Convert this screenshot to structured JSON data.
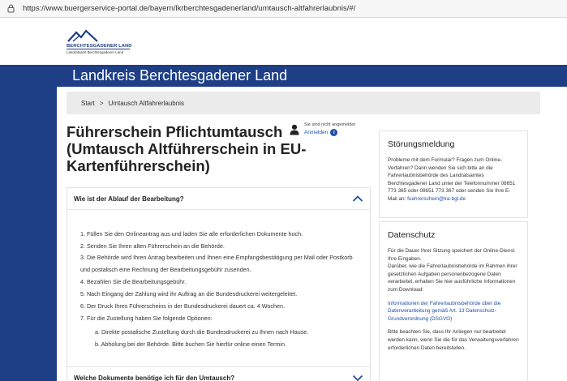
{
  "browser": {
    "url": "https://www.buergerservice-portal.de/bayern/lkrberchtesgadenerland/umtausch-altfahrerlaubnis/#/"
  },
  "logo": {
    "title": "BERCHTESGADENER LAND",
    "subtitle": "Landratsamt Berchtesgadener Land"
  },
  "banner": {
    "title": "Landkreis Berchtesgadener Land"
  },
  "breadcrumb": {
    "home": "Start",
    "separator": ">",
    "current": "Umtausch Altfahrerlaubnis"
  },
  "page": {
    "title": "Führerschein Pflichtumtausch (Umtausch Altführerschein in EU-Kartenführerschein)"
  },
  "login": {
    "state": "Sie sind nicht angemeldet",
    "link": "Anmelden",
    "info_icon": "i"
  },
  "accordion1": {
    "title": "Wie ist der Ablauf der Bearbeitung?",
    "steps": [
      "1. Füllen Sie den Onlineantrag aus und laden Sie alle erforderlichen Dokumente hoch.",
      "2. Senden Sie Ihren alten Führerschein an die Behörde.",
      "3. Die Behörde wird Ihren Antrag bearbeiten und Ihnen eine Empfangsbestätigung per Mail oder Postkorb und postalisch eine Rechnung der Bearbeitungsgebühr zusenden.",
      "4. Bezahlen Sie die Bearbeitungsgebühr.",
      "5. Nach Eingang der Zahlung wird ihr Auftrag an die Bundesdruckerei weitergeleitet.",
      "6. Der Druck Ihres Führerscheins in der Bundesdruckerei dauert ca. 4 Wochen.",
      "7. Für die Zustellung haben Sie folgende Optionen:"
    ],
    "options": [
      "a. Direkte postalische Zustellung durch die Bundesdruckerei zu Ihnen nach Hause.",
      "b. Abholung bei der Behörde. Bitte buchen Sie hierfür online einen Termin."
    ]
  },
  "accordion2": {
    "title": "Welche Dokumente benötige ich für den Umtausch?"
  },
  "stoerung": {
    "title": "Störungsmeldung",
    "text": "Probleme mit dem Formular? Fragen zum Online-Verfahren? Dann wenden Sie sich bitte an die Fahrerlaubnisbehörde des Landratsamtes Berchtesgadener Land unter der Telefonnummer 08651 773 365 oder 08651 773 367 oder senden Sie Ihre E-Mail an: ",
    "email": "fuehrerschein@lra-bgl.de"
  },
  "datenschutz": {
    "title": "Datenschutz",
    "text1": "Für die Dauer Ihrer Sitzung speichert der Online-Dienst Ihre Eingaben.",
    "text2": "Darüber, wie die Fahrerlaubnisbehörde im Rahmen ihrer gesetzlichen Aufgaben personenbezogene Daten verarbeitet, erhalten Sie hier ausführliche Informationen zum Download:",
    "link": "Informationen der Fahrerlaubnisbehörde über die Datenverarbeitung gemäß Art. 13 Datenschutz-Grundverordnung (DSGVO)",
    "text3": "Bitte beachten Sie, dass Ihr Anliegen nur bearbeitet werden kann, wenn Sie die für das Verwaltungsverfahren erforderlichen Daten bereitstellen."
  },
  "colors": {
    "brand_blue": "#1e3f86",
    "link_blue": "#1e4ea8",
    "crumb_bg": "#ebebeb"
  }
}
